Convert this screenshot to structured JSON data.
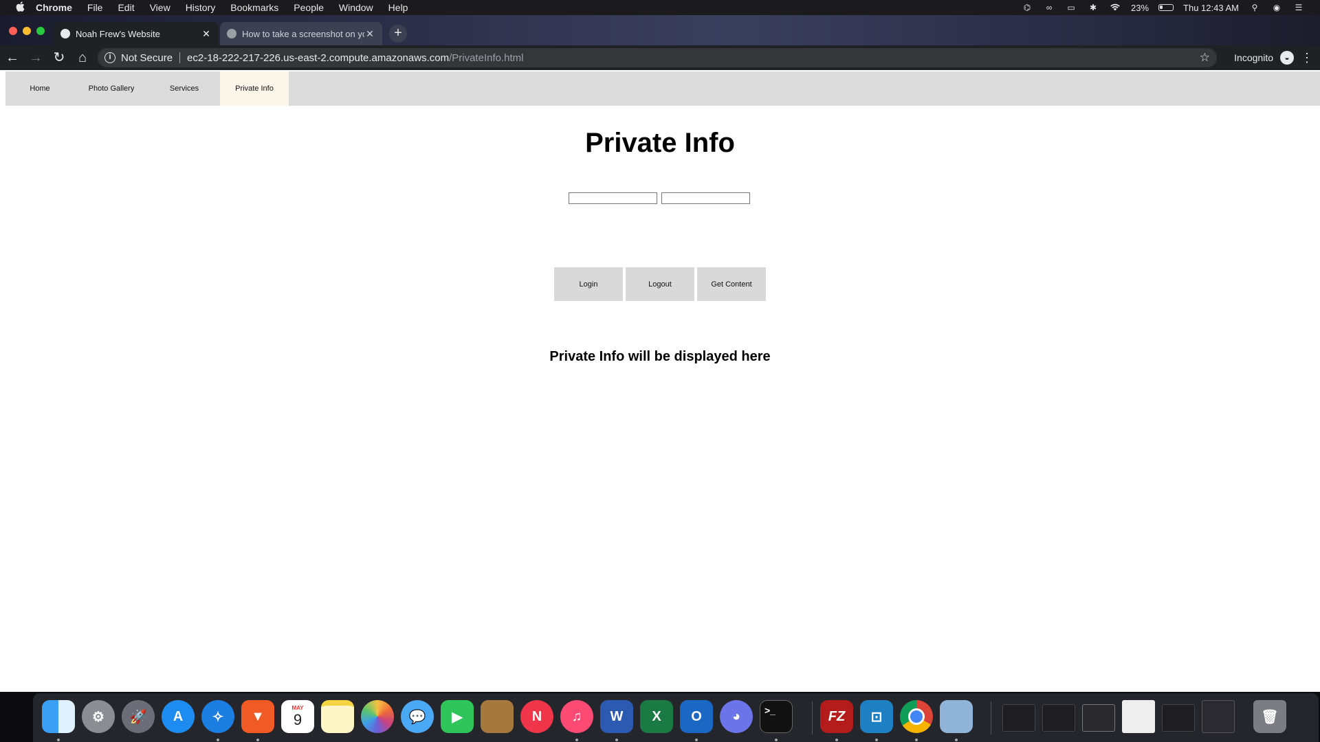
{
  "menubar": {
    "apple": "",
    "items": [
      "Chrome",
      "File",
      "Edit",
      "View",
      "History",
      "Bookmarks",
      "People",
      "Window",
      "Help"
    ],
    "battery_percent": "23%",
    "battery_level": 0.23,
    "clock": "Thu 12:43 AM",
    "status_icons": [
      "glasses-icon",
      "creative-cloud-icon",
      "airplay-icon",
      "bluetooth-icon",
      "wifi-icon",
      "battery-icon",
      "spotlight-search-icon",
      "siri-icon",
      "notification-center-icon"
    ]
  },
  "tabs": [
    {
      "title": "Noah Frew's Website",
      "active": true
    },
    {
      "title": "How to take a screenshot on your Mac - Apple Support",
      "active": false
    }
  ],
  "toolbar": {
    "security_label": "Not Secure",
    "url_host": "ec2-18-222-217-226.us-east-2.compute.amazonaws.com",
    "url_path": "/PrivateInfo.html",
    "profile_label": "Incognito"
  },
  "nav": {
    "items": [
      {
        "label": "Home"
      },
      {
        "label": "Photo Gallery"
      },
      {
        "label": "Services"
      },
      {
        "label": "Private Info",
        "active": true
      }
    ]
  },
  "main": {
    "title": "Private Info",
    "username_value": "",
    "password_value": "",
    "buttons": {
      "login": "Login",
      "logout": "Logout",
      "get_content": "Get Content"
    },
    "message": "Private Info will be displayed here"
  },
  "dock": {
    "apps": [
      "finder",
      "system-preferences",
      "launchpad",
      "app-store",
      "safari",
      "brave",
      "calendar",
      "notes",
      "photos",
      "messages",
      "facetime",
      "contacts",
      "news",
      "itunes",
      "word",
      "excel",
      "outlook",
      "discord",
      "terminal",
      "filezilla",
      "parallels",
      "chrome",
      "preview"
    ],
    "calendar_month": "MAY",
    "calendar_day": "9",
    "terminal_glyph": ">_"
  },
  "colors": {
    "nav_bg": "#dcdcdc",
    "nav_active_bg": "#fdf6ea",
    "button_bg": "#d9d9d9",
    "chrome_dark": "#202124"
  }
}
